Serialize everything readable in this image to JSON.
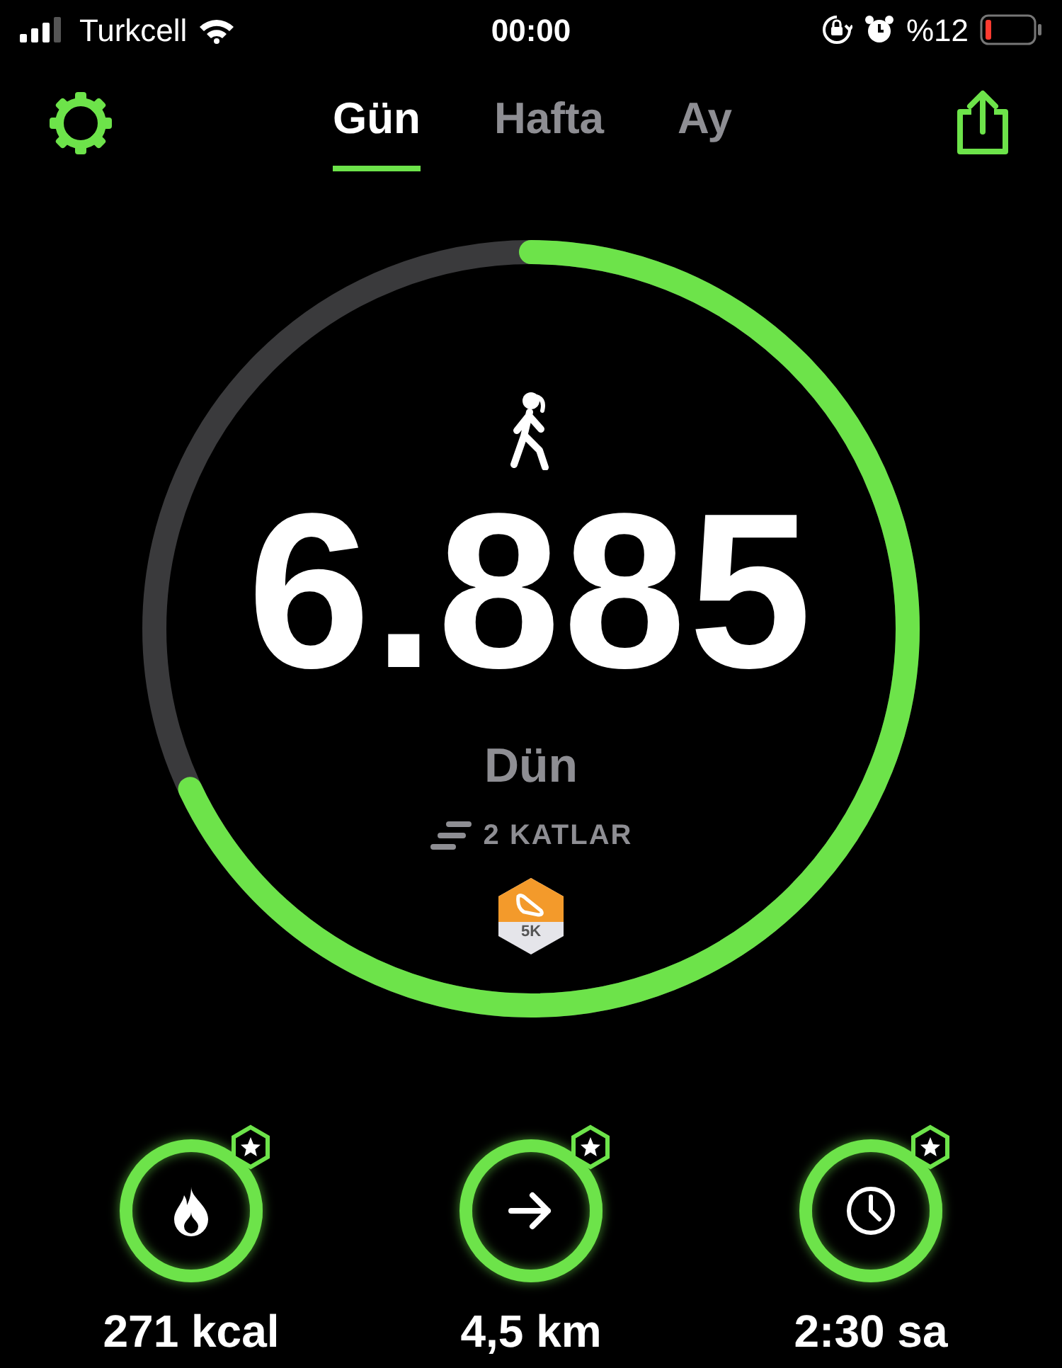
{
  "status_bar": {
    "carrier": "Turkcell",
    "time": "00:00",
    "battery": "%12"
  },
  "tabs": [
    {
      "label": "Gün",
      "selected": true
    },
    {
      "label": "Hafta",
      "selected": false
    },
    {
      "label": "Ay",
      "selected": false
    }
  ],
  "steps": {
    "value": "6.885",
    "level": 0.68,
    "day": "Dün",
    "floors": "2 KATLAR",
    "badge": "5K"
  },
  "stats": [
    {
      "kind": "calories",
      "value": "271 kcal",
      "level": 1,
      "goal_reached": true
    },
    {
      "kind": "distance",
      "value": "4,5 km",
      "level": 1,
      "goal_reached": true
    },
    {
      "kind": "duration",
      "value": "2:30 sa",
      "level": 1,
      "goal_reached": true
    }
  ]
}
